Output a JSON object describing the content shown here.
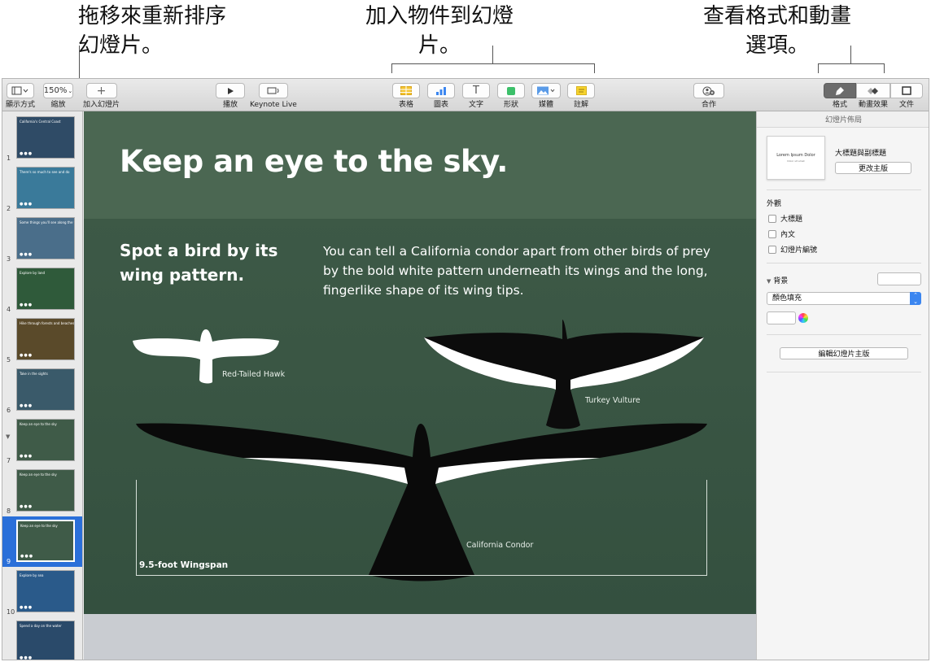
{
  "callouts": {
    "reorder": "拖移來重新排序幻燈片。",
    "add_objects": "加入物件到幻燈片。",
    "format_options": "查看格式和動畫選項。"
  },
  "toolbar": {
    "view_label": "顯示方式",
    "zoom_value": "150%",
    "zoom_label": "縮放",
    "add_slide_label": "加入幻燈片",
    "play_label": "播放",
    "keynote_live_label": "Keynote Live",
    "table_label": "表格",
    "chart_label": "圖表",
    "text_label": "文字",
    "shape_label": "形狀",
    "media_label": "媒體",
    "comment_label": "註解",
    "collaborate_label": "合作",
    "format_label": "格式",
    "animate_label": "動畫效果",
    "document_label": "文件"
  },
  "navigator": {
    "slides": [
      {
        "num": "1",
        "title": "California's Central Coast",
        "selected": false
      },
      {
        "num": "2",
        "title": "There's so much to see and do",
        "selected": false
      },
      {
        "num": "3",
        "title": "Some things you'll see along the way",
        "selected": false
      },
      {
        "num": "4",
        "title": "Explore by land",
        "selected": false
      },
      {
        "num": "5",
        "title": "Hike through forests and beaches",
        "selected": false
      },
      {
        "num": "6",
        "title": "Take in the sights",
        "selected": false
      },
      {
        "num": "7",
        "title": "Keep an eye to the sky",
        "selected": false
      },
      {
        "num": "8",
        "title": "Keep an eye to the sky",
        "selected": false
      },
      {
        "num": "9",
        "title": "Keep an eye to the sky",
        "selected": true
      },
      {
        "num": "10",
        "title": "Explore by sea",
        "selected": false
      },
      {
        "num": "11",
        "title": "Spend a day on the water",
        "selected": false
      }
    ],
    "dots": "●●●"
  },
  "slide": {
    "title": "Keep an eye to the sky.",
    "subtitle": "Spot a bird by its wing pattern.",
    "body": "You can tell a California condor apart from other birds of prey by the bold white pattern underneath its wings and the long, fingerlike shape of its wing tips.",
    "hawk_label": "Red-Tailed Hawk",
    "vulture_label": "Turkey Vulture",
    "condor_label": "California Condor",
    "wingspan_label": "9.5-foot Wingspan"
  },
  "inspector": {
    "header": "幻燈片佈局",
    "layout_thumb_title": "Lorem Ipsum Dolor",
    "layout_thumb_sub": "Dolor sit amet",
    "layout_name": "大標題與副標題",
    "change_master_button": "更改主版",
    "appearance_heading": "外觀",
    "title_checkbox": "大標題",
    "body_checkbox": "內文",
    "slide_number_checkbox": "幻燈片編號",
    "background_heading": "背景",
    "fill_select": "顏色填充",
    "edit_master_button": "編輯幻燈片主版"
  },
  "colors": {
    "slide_green": "#3f5b48",
    "selection_blue": "#2a6fd9",
    "toolbar_yellow": "#f4c430",
    "toolbar_blue": "#3b86f0",
    "toolbar_green": "#3cc06a"
  }
}
